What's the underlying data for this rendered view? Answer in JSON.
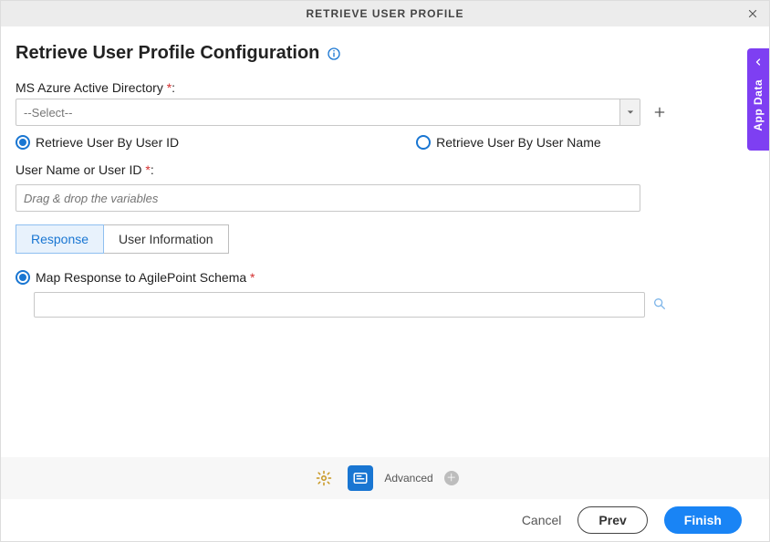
{
  "header": {
    "title": "RETRIEVE USER PROFILE"
  },
  "sideTab": {
    "label": "App Data"
  },
  "page": {
    "title": "Retrieve User Profile Configuration"
  },
  "fields": {
    "directoryLabel": "MS Azure Active Directory ",
    "directoryLabelSep": ":",
    "directorySelected": "--Select--",
    "retrieveByIdLabel": "Retrieve User By User ID",
    "retrieveByNameLabel": "Retrieve User By User Name",
    "userIdLabel": "User Name or User ID ",
    "userIdLabelSep": ":",
    "userIdPlaceholder": "Drag & drop the variables",
    "mapResponseLabel": "Map Response to AgilePoint Schema "
  },
  "tabs": {
    "response": "Response",
    "userInfo": "User Information"
  },
  "toolbar": {
    "advancedLabel": "Advanced",
    "advancedPlus": "＋"
  },
  "footer": {
    "cancel": "Cancel",
    "prev": "Prev",
    "finish": "Finish"
  },
  "required": "*"
}
